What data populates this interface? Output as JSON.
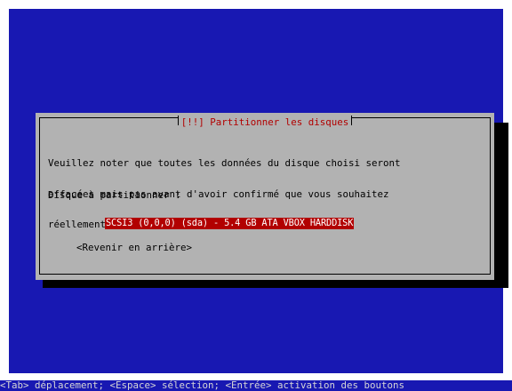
{
  "dialog": {
    "title": "[!!] Partitionner les disques",
    "message_lines": [
      "Veuillez noter que toutes les données du disque choisi seront",
      "effacées mais pas avant d'avoir confirmé que vous souhaitez",
      "réellement effectuer les modifications."
    ],
    "disk_prompt": "Disque à partitionner :",
    "disk_options": [
      "SCSI3 (0,0,0) (sda) - 5.4 GB ATA VBOX HARDDISK"
    ],
    "selected_disk_index": 0,
    "back_button_label": "<Revenir en arrière>"
  },
  "status_bar": {
    "help_text": "<Tab> déplacement; <Espace> sélection; <Entrée> activation des boutons"
  },
  "colors": {
    "screen_background": "#1818b2",
    "dialog_background": "#b2b2b2",
    "title_text": "#b20000",
    "selection_background": "#b20000",
    "selection_text": "#ffffff"
  }
}
